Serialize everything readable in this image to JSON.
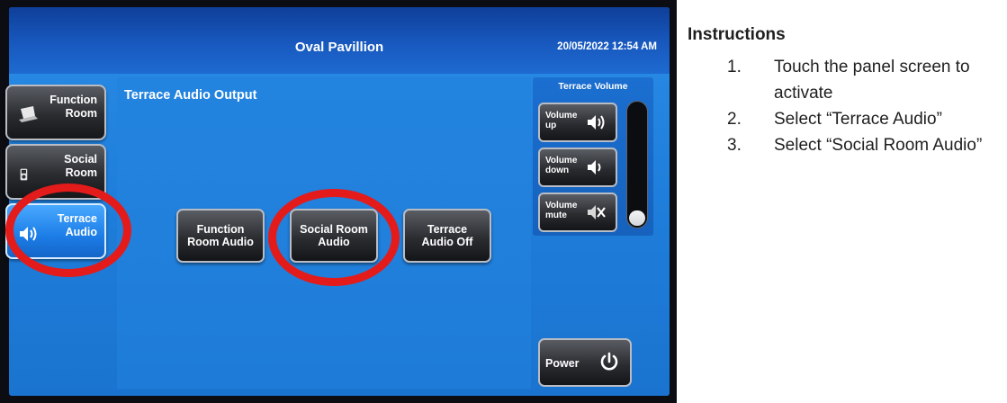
{
  "panel": {
    "title": "Oval Pavillion",
    "datetime": "20/05/2022 12:54 AM",
    "section_title": "Terrace Audio Output",
    "nav": [
      {
        "line1": "Function",
        "line2": "Room",
        "icon": "laptop-icon",
        "active": false
      },
      {
        "line1": "Social",
        "line2": "Room",
        "icon": "ipod-icon",
        "active": false
      },
      {
        "line1": "Terrace",
        "line2": "Audio",
        "icon": "speaker-icon",
        "active": true
      }
    ],
    "options": [
      {
        "line1": "Function",
        "line2": "Room Audio"
      },
      {
        "line1": "Social Room",
        "line2": "Audio"
      },
      {
        "line1": "Terrace",
        "line2": "Audio Off"
      }
    ],
    "volume": {
      "title": "Terrace Volume",
      "buttons": [
        {
          "line1": "Volume",
          "line2": "up",
          "icon": "speaker-up-icon"
        },
        {
          "line1": "Volume",
          "line2": "down",
          "icon": "speaker-down-icon"
        },
        {
          "line1": "Volume",
          "line2": "mute",
          "icon": "speaker-mute-icon"
        }
      ],
      "level_fraction": 0.12
    },
    "power_label": "Power",
    "accent_color": "#e31b1b"
  },
  "instructions": {
    "title": "Instructions",
    "steps": [
      {
        "num": "1.",
        "text": "Touch the panel screen to activate"
      },
      {
        "num": "2.",
        "text": "Select “Terrace Audio”"
      },
      {
        "num": "3.",
        "text": "Select “Social Room Audio”"
      }
    ]
  }
}
